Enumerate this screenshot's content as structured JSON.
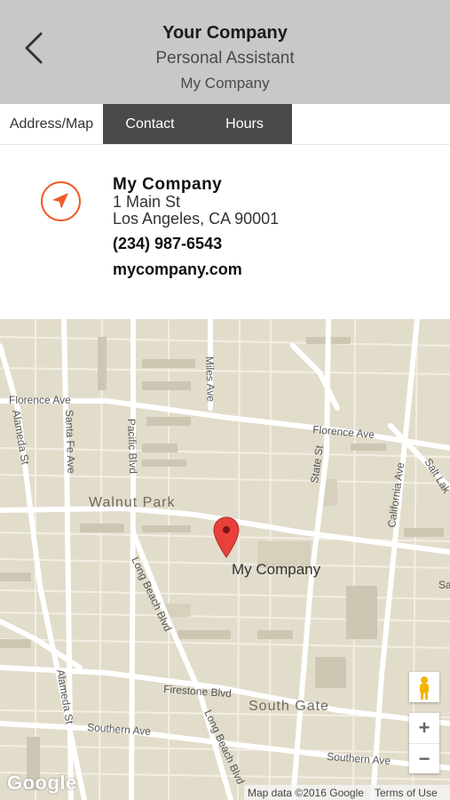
{
  "header": {
    "title": "Your Company",
    "subtitle": "Personal Assistant",
    "subtitle2": "My Company",
    "back_icon": "chevron-left-icon"
  },
  "tabs": [
    {
      "label": "Address/Map",
      "active": true
    },
    {
      "label": "Contact",
      "active": false
    },
    {
      "label": "Hours",
      "active": false
    }
  ],
  "card": {
    "icon": "navigation-arrow-icon",
    "accent_color": "#f05a28",
    "name": "My Company",
    "address_line1": "1 Main St",
    "address_line2": "Los Angeles, CA 90001",
    "phone": "(234) 987-6543",
    "website": "mycompany.com"
  },
  "map": {
    "pin_label": "My Company",
    "streets": {
      "florence_ave_w": "Florence Ave",
      "florence_ave_e": "Florence Ave",
      "alameda_st_n": "Alameda St",
      "alameda_st_s": "Alameda St",
      "santa_fe_ave": "Santa Fe Ave",
      "pacific_blvd": "Pacific Blvd",
      "miles_ave": "Miles Ave",
      "state_st": "State St",
      "california_ave": "California Ave",
      "salt_lake": "Salt Lak",
      "long_beach_blvd_n": "Long Beach Blvd",
      "long_beach_blvd_s": "Long Beach Blvd",
      "firestone_blvd": "Firestone Blvd",
      "southern_ave_w": "Southern Ave",
      "southern_ave_e": "Southern Ave",
      "sa": "Sa"
    },
    "areas": {
      "walnut_park": "Walnut Park",
      "south_gate": "South Gate"
    },
    "logo": "Google",
    "attribution": "Map data ©2016 Google",
    "terms": "Terms of Use",
    "zoom_in": "+",
    "zoom_out": "−"
  }
}
